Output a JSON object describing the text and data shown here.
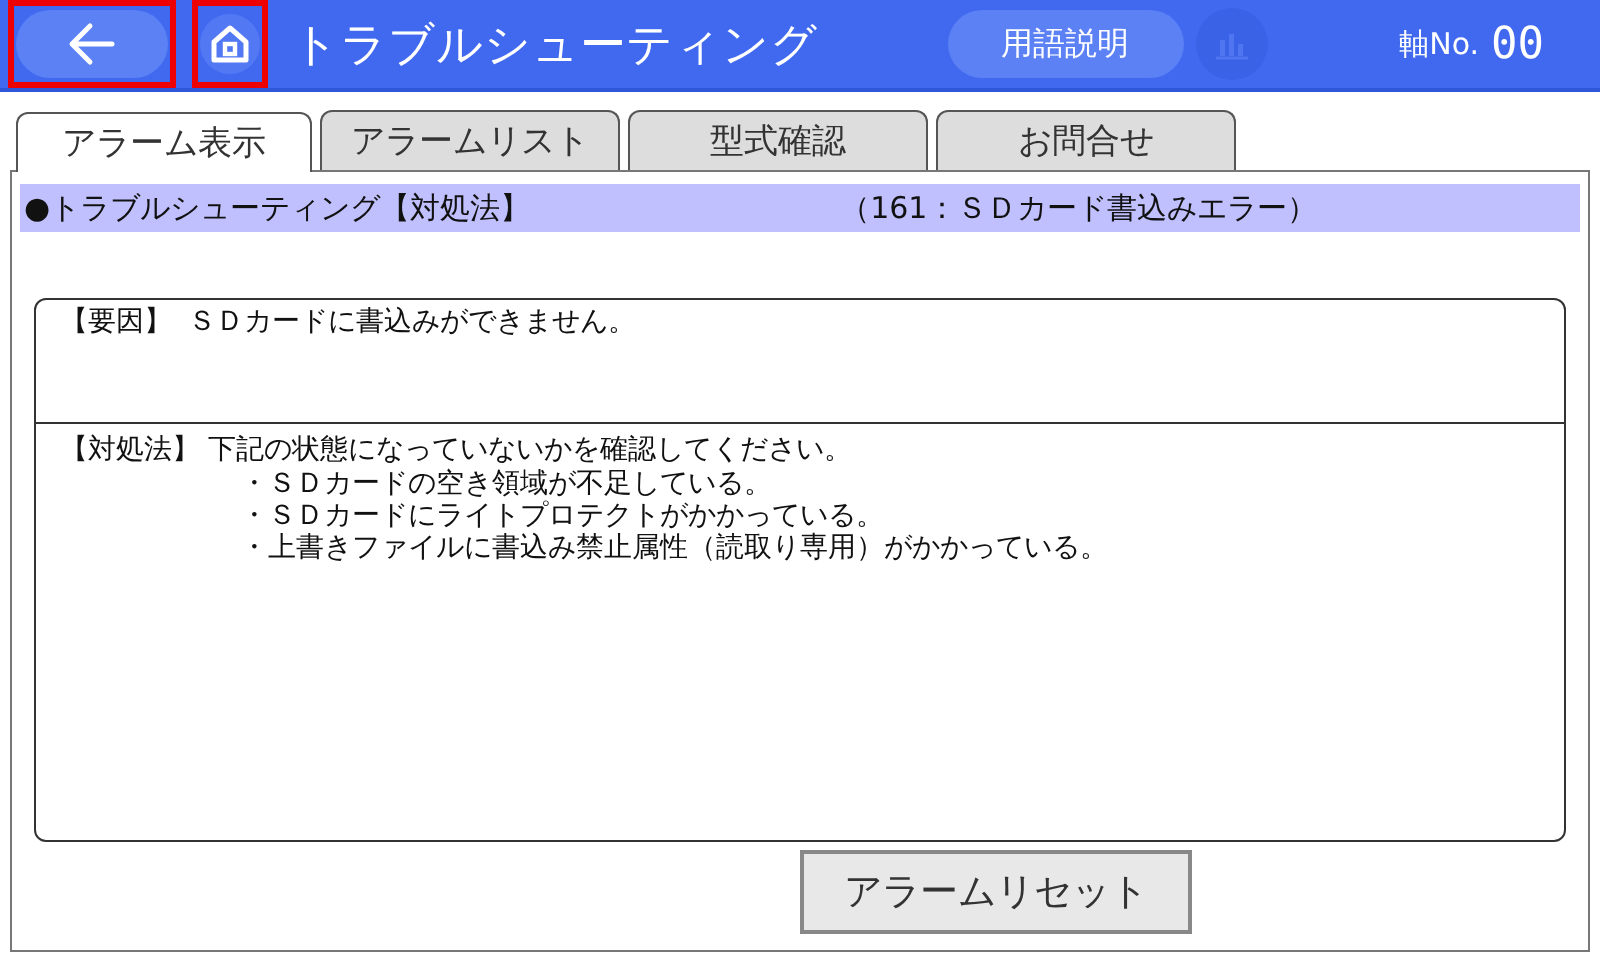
{
  "header": {
    "back_button": {
      "highlighted": true
    },
    "home_button": {
      "highlighted": true
    },
    "title": "トラブルシューティング",
    "glossary_button": "用語説明",
    "chart_button": {
      "disabled": true
    },
    "axis_label": "軸No.",
    "axis_value": "00"
  },
  "tabs": [
    {
      "label": "アラーム表示",
      "selected": true
    },
    {
      "label": "アラームリスト",
      "selected": false
    },
    {
      "label": "型式確認",
      "selected": false
    },
    {
      "label": "お問合せ",
      "selected": false
    }
  ],
  "heading": {
    "title": "●トラブルシューティング【対処法】",
    "alarm": "（161：ＳＤカード書込みエラー）"
  },
  "cause": {
    "label": "【要因】",
    "text": "ＳＤカードに書込みができません。"
  },
  "remedy": {
    "label": "【対処法】",
    "text": "下記の状態になっていないかを確認してください。",
    "items": [
      "・ＳＤカードの空き領域が不足している。",
      "・ＳＤカードにライトプロテクトがかかっている。",
      "・上書きファイルに書込み禁止属性（読取り専用）がかかっている。"
    ]
  },
  "reset_button": "アラームリセット"
}
